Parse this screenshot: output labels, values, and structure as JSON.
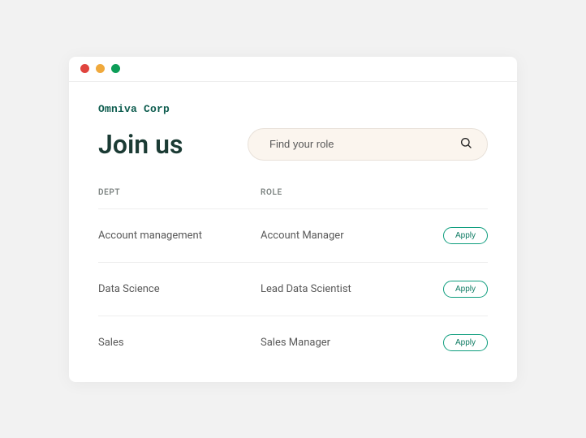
{
  "brand": "Omniva Corp",
  "heading": "Join us",
  "search": {
    "placeholder": "Find your role"
  },
  "table": {
    "headers": {
      "dept": "DEPT",
      "role": "ROLE"
    },
    "rows": [
      {
        "dept": "Account management",
        "role": "Account Manager",
        "cta": "Apply"
      },
      {
        "dept": "Data Science",
        "role": "Lead Data Scientist",
        "cta": "Apply"
      },
      {
        "dept": "Sales",
        "role": "Sales Manager",
        "cta": "Apply"
      }
    ]
  }
}
